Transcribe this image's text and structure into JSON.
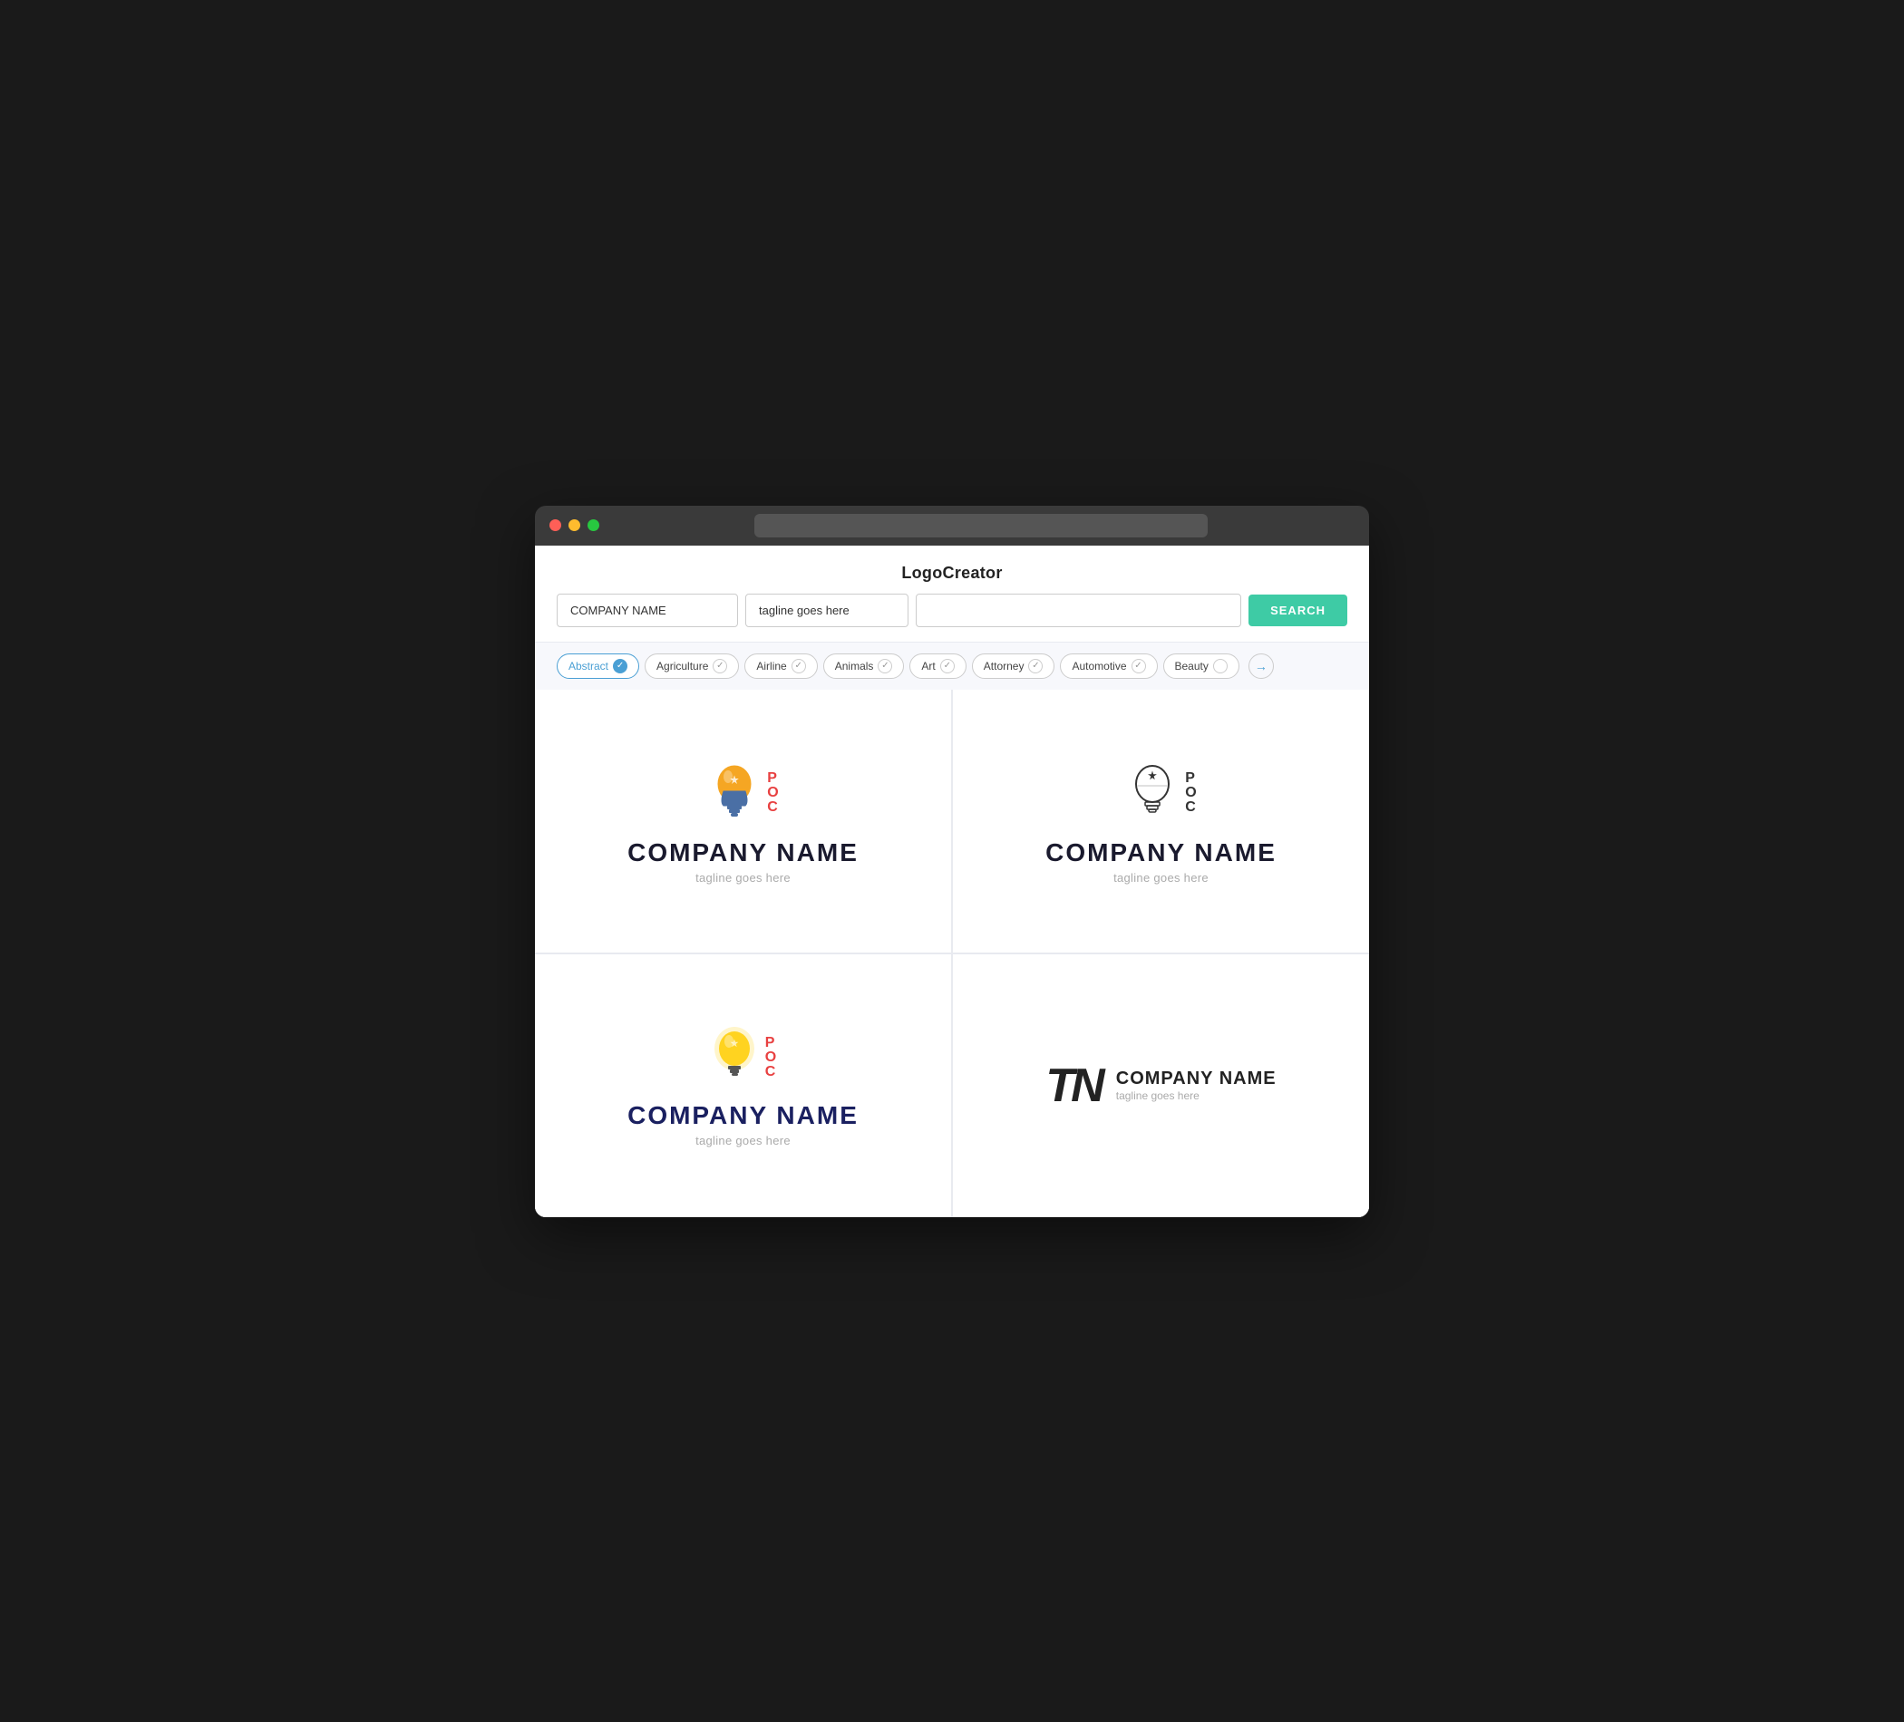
{
  "app": {
    "title": "LogoCreator"
  },
  "search": {
    "company_placeholder": "COMPANY NAME",
    "tagline_placeholder": "tagline goes here",
    "keyword_placeholder": "",
    "search_button_label": "SEARCH"
  },
  "filters": [
    {
      "id": "abstract",
      "label": "Abstract",
      "active": true
    },
    {
      "id": "agriculture",
      "label": "Agriculture",
      "active": false
    },
    {
      "id": "airline",
      "label": "Airline",
      "active": false
    },
    {
      "id": "animals",
      "label": "Animals",
      "active": false
    },
    {
      "id": "art",
      "label": "Art",
      "active": false
    },
    {
      "id": "attorney",
      "label": "Attorney",
      "active": false
    },
    {
      "id": "automotive",
      "label": "Automotive",
      "active": false
    },
    {
      "id": "beauty",
      "label": "Beauty",
      "active": false
    }
  ],
  "logos": [
    {
      "id": "logo1",
      "type": "colored-bulb",
      "company": "COMPANY NAME",
      "tagline": "tagline goes here",
      "poc": [
        "P",
        "O",
        "C"
      ]
    },
    {
      "id": "logo2",
      "type": "outline-bulb",
      "company": "COMPANY NAME",
      "tagline": "tagline goes here",
      "poc": [
        "P",
        "O",
        "C"
      ]
    },
    {
      "id": "logo3",
      "type": "yellow-bulb",
      "company": "COMPANY NAME",
      "tagline": "tagline goes here",
      "poc": [
        "P",
        "O",
        "C"
      ]
    },
    {
      "id": "logo4",
      "type": "tn-monogram",
      "company": "COMPANY NAME",
      "tagline": "tagline goes here"
    }
  ]
}
